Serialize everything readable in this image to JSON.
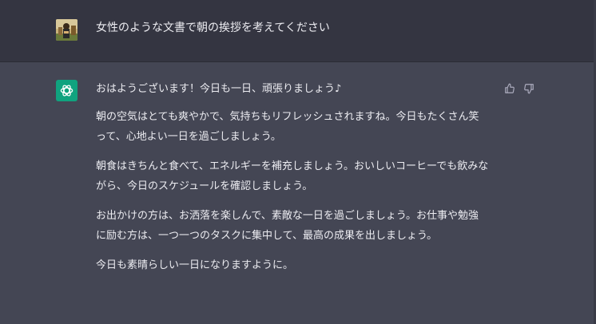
{
  "user": {
    "message": "女性のような文書で朝の挨拶を考えてください"
  },
  "assistant": {
    "greeting": "おはようございます！今日も一日、頑張りましょう♪",
    "paragraph_1": "朝の空気はとても爽やかで、気持ちもリフレッシュされますね。今日もたくさん笑って、心地よい一日を過ごしましょう。",
    "paragraph_2": "朝食はきちんと食べて、エネルギーを補充しましょう。おいしいコーヒーでも飲みながら、今日のスケジュールを確認しましょう。",
    "paragraph_3": "お出かけの方は、お洒落を楽しんで、素敵な一日を過ごしましょう。お仕事や勉強に励む方は、一つ一つのタスクに集中して、最高の成果を出しましょう。",
    "closing": "今日も素晴らしい一日になりますように。"
  },
  "icons": {
    "user_avatar": "user-avatar-image",
    "assistant_avatar": "openai-logo-icon",
    "thumbs_up": "thumbs-up-icon",
    "thumbs_down": "thumbs-down-icon"
  },
  "colors": {
    "user_row_bg": "#343541",
    "assistant_row_bg": "#444654",
    "assistant_avatar_bg": "#10a37f",
    "text": "#ececf1",
    "icon": "#acacbe"
  }
}
